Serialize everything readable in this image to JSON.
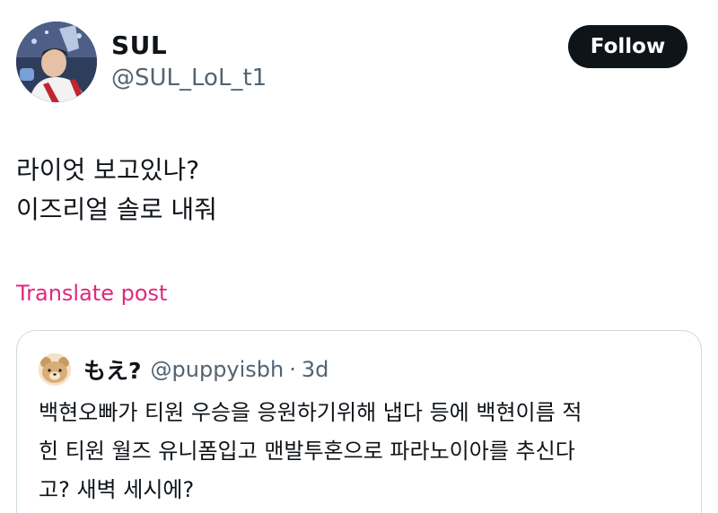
{
  "author": {
    "name": "SUL",
    "handle": "@SUL_LoL_t1",
    "avatar_icon": "profile-photo-icon"
  },
  "follow_button": {
    "label": "Follow"
  },
  "post": {
    "lines": [
      "라이엇 보고있나?",
      "이즈리얼 솔로 내줘"
    ]
  },
  "translate_link": {
    "label": "Translate post",
    "color": "#e0287f"
  },
  "quoted_post": {
    "author_name": "もえ?",
    "handle": "@puppyisbh",
    "separator": "·",
    "time": "3d",
    "avatar_icon": "bear-avatar-icon",
    "lines": [
      "백현오빠가 티원 우승을 응원하기위해 냅다 등에 백현이름 적",
      "힌 티원 월즈 유니폼입고 맨발투혼으로 파라노이아를 추신다",
      "고? 새벽 세시에?"
    ]
  }
}
